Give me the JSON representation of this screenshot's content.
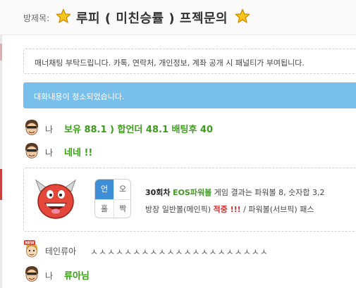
{
  "header": {
    "room_label": "방제목:",
    "room_title": "루피 ( 미친승률 ) 프젝문의"
  },
  "notice": "매너채팅 부탁드립니다. 카톡, 연락처, 개인정보, 계좌 공개 시 패널티가 부여됩니다.",
  "cleared_banner": "대화내용이 청소되었습니다.",
  "messages": [
    {
      "nick": "나",
      "text": "보유 88.1 ) 합언더 48.1 배팅후 40"
    },
    {
      "nick": "나",
      "text": "네네 !!"
    }
  ],
  "result_card": {
    "pick_cells": [
      "언",
      "오",
      "홀",
      "짝"
    ],
    "line1": {
      "round": "30회차",
      "game": "EOS파워볼",
      "rest": "게임 결과는 파워볼 8, 숫자합 3,2"
    },
    "line2": {
      "main_label": "방장 일반볼(메인픽)",
      "main_result": "적중 !!!",
      "sep": "/",
      "sub_label": "파워볼(서브픽)",
      "sub_result": "패스"
    }
  },
  "messages_after": [
    {
      "nick": "테인류아",
      "text": "ㅅㅅㅅㅅㅅㅅㅅㅅㅅㅅㅅㅅㅅㅅㅅㅅㅅㅅㅅㅅㅅ",
      "badge": "NEW"
    },
    {
      "nick": "나",
      "text": "류아님"
    }
  ],
  "colors": {
    "accent_blue": "#78bfec",
    "chat_green": "#3e9b1e",
    "hit_red": "#e02d2d",
    "pick_selected": "#3f8fd8"
  }
}
